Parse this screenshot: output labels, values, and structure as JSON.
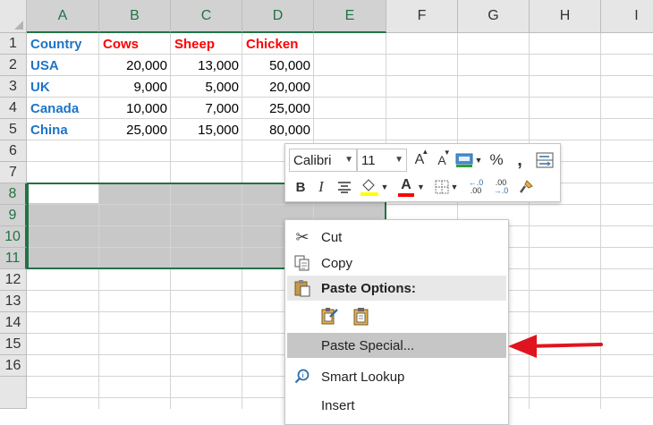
{
  "columns": [
    "A",
    "B",
    "C",
    "D",
    "E",
    "F",
    "G",
    "H",
    "I"
  ],
  "rows": [
    "1",
    "2",
    "3",
    "4",
    "5",
    "6",
    "7",
    "8",
    "9",
    "10",
    "11",
    "12",
    "13",
    "14",
    "15",
    "16"
  ],
  "cells": {
    "header": [
      "Country",
      "Cows",
      "Sheep",
      "Chicken"
    ],
    "data": [
      [
        "USA",
        "20,000",
        "13,000",
        "50,000"
      ],
      [
        "UK",
        "9,000",
        "5,000",
        "20,000"
      ],
      [
        "Canada",
        "10,000",
        "7,000",
        "25,000"
      ],
      [
        "China",
        "25,000",
        "15,000",
        "80,000"
      ]
    ]
  },
  "colors": {
    "country_text": "#1e74c6",
    "animal_header_text": "#ff0000",
    "selection_border": "#217346",
    "arrow": "#e0141e"
  },
  "mini_toolbar": {
    "font_name": "Calibri",
    "font_size": "11",
    "icons": [
      "increase-font-size-icon",
      "decrease-font-size-icon",
      "accounting-format-icon",
      "percent-icon",
      "comma-style-icon",
      "wrap-text-icon",
      "bold-icon",
      "italic-icon",
      "align-center-icon",
      "fill-color-icon",
      "font-color-icon",
      "borders-icon",
      "increase-decimal-icon",
      "decrease-decimal-icon",
      "format-painter-icon"
    ],
    "bold": "B",
    "italic": "I",
    "percent": "%",
    "comma": ",",
    "grow": "A",
    "shrink": "A",
    "font_color": "A",
    "inc_decimal_top": "←.0",
    "inc_decimal_bottom": ".00",
    "dec_decimal_top": ".00",
    "dec_decimal_bottom": "→.0"
  },
  "context_menu": {
    "cut": "Cut",
    "copy": "Copy",
    "paste_options": "Paste Options:",
    "paste_special": "Paste Special...",
    "smart_lookup": "Smart Lookup",
    "insert": "Insert"
  }
}
